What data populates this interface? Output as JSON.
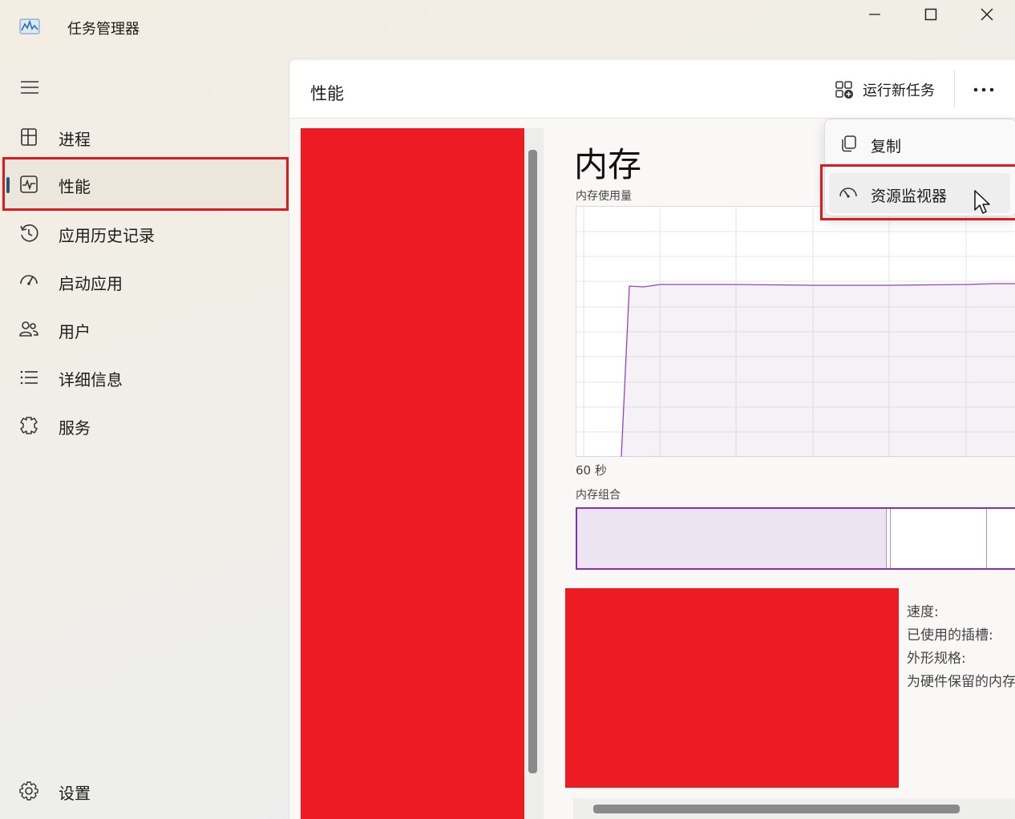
{
  "window": {
    "title": "任务管理器",
    "icons": {
      "app": "performance-graph-icon",
      "minimize": "minimize-icon",
      "maximize": "maximize-icon",
      "close": "close-icon"
    }
  },
  "sidebar": {
    "menu_icon": "hamburger-icon",
    "items": [
      {
        "label": "进程",
        "icon": "processes-icon"
      },
      {
        "label": "性能",
        "icon": "performance-icon",
        "active": true
      },
      {
        "label": "应用历史记录",
        "icon": "history-icon"
      },
      {
        "label": "启动应用",
        "icon": "startup-icon"
      },
      {
        "label": "用户",
        "icon": "users-icon"
      },
      {
        "label": "详细信息",
        "icon": "details-list-icon"
      },
      {
        "label": "服务",
        "icon": "services-icon"
      }
    ],
    "settings": {
      "label": "设置",
      "icon": "gear-icon"
    }
  },
  "header": {
    "title": "性能",
    "run_task_label": "运行新任务",
    "more_icon": "more-icon"
  },
  "menu": {
    "items": [
      {
        "label": "复制",
        "icon": "copy-icon"
      },
      {
        "label": "资源监视器",
        "icon": "gauge-icon",
        "hovered": true
      }
    ]
  },
  "memory": {
    "title": "内存",
    "usage_label": "内存使用量",
    "time_label": "60 秒",
    "composition_label": "内存组合",
    "stats": [
      "速度:",
      "已使用的插槽:",
      "外形规格:",
      "为硬件保留的内存"
    ]
  },
  "colors": {
    "accent": "#1f5a78",
    "memory_line": "#9b3fc2",
    "highlight": "#e0191e",
    "redaction": "#ed1c24"
  }
}
